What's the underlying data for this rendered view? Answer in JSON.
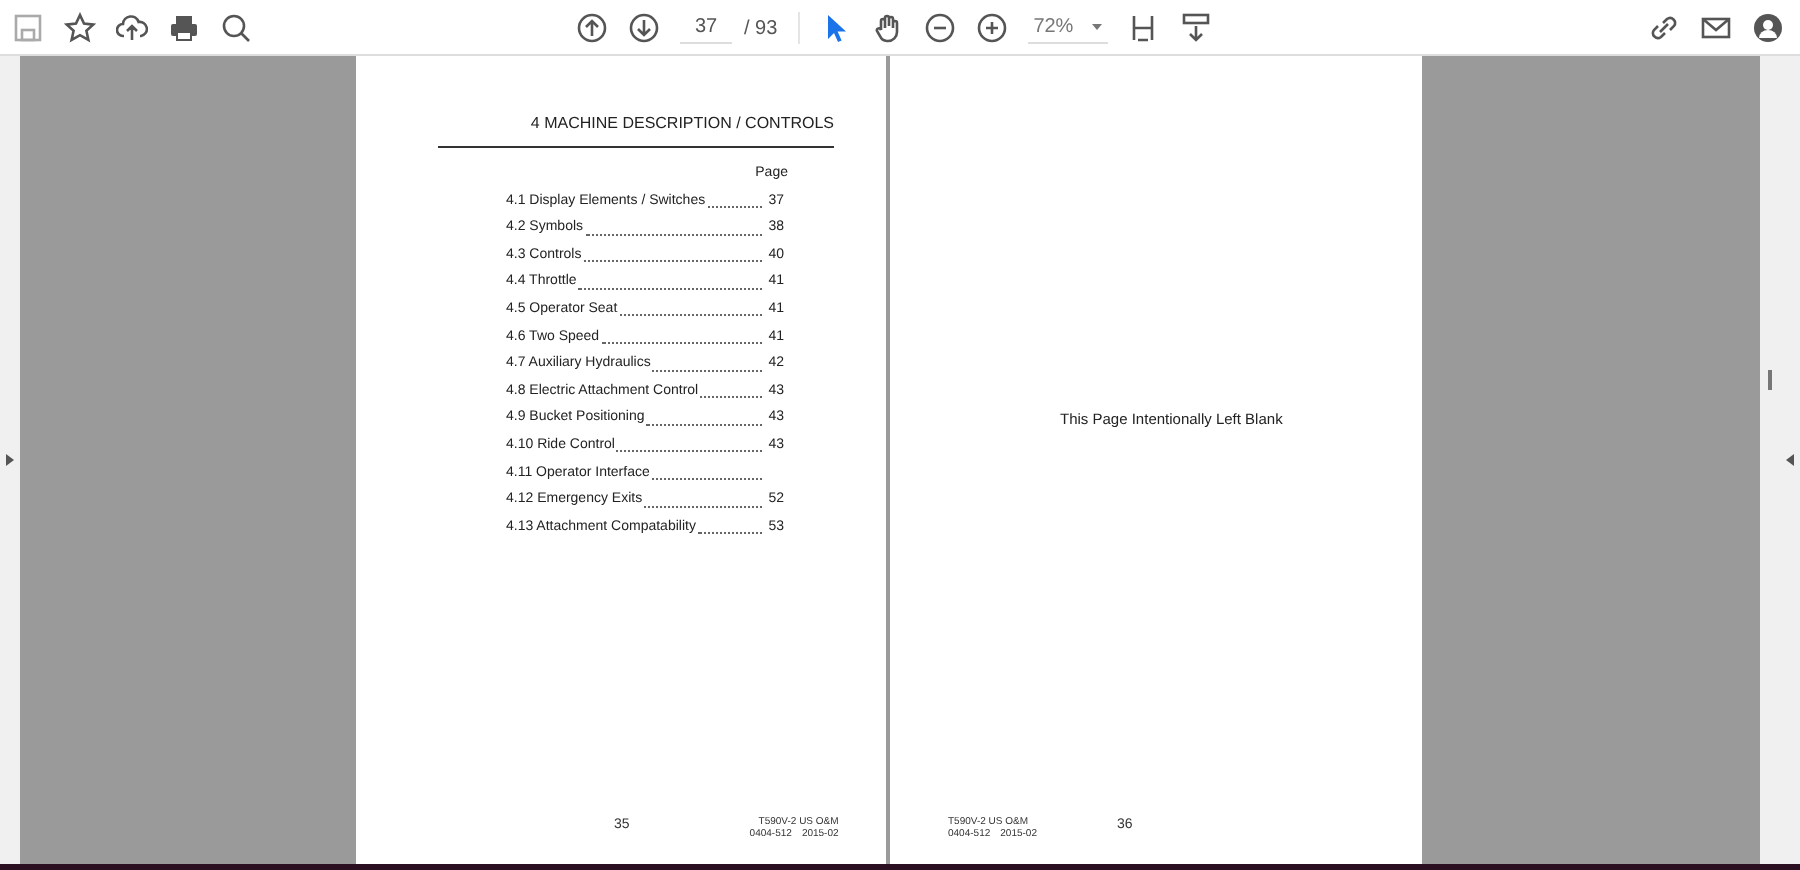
{
  "toolbar": {
    "page_number": "37",
    "page_total": "/ 93",
    "zoom": "72%"
  },
  "left_page": {
    "heading": "4 MACHINE DESCRIPTION / CONTROLS",
    "page_column_label": "Page",
    "entries": [
      {
        "title": "4.1 Display Elements / Switches",
        "page": "37"
      },
      {
        "title": "4.2 Symbols",
        "page": "38"
      },
      {
        "title": "4.3 Controls",
        "page": "40"
      },
      {
        "title": "4.4 Throttle",
        "page": "41"
      },
      {
        "title": "4.5 Operator Seat",
        "page": "41"
      },
      {
        "title": "4.6 Two Speed",
        "page": "41"
      },
      {
        "title": "4.7 Auxiliary Hydraulics",
        "page": "42"
      },
      {
        "title": "4.8 Electric Attachment Control",
        "page": "43"
      },
      {
        "title": "4.9 Bucket Positioning",
        "page": "43"
      },
      {
        "title": "4.10 Ride Control",
        "page": "43"
      },
      {
        "title": "4.11 Operator Interface"
      },
      {
        "title": "4.12 Emergency Exits",
        "page": "52"
      },
      {
        "title": "4.13 Attachment Compatability",
        "page": "53"
      }
    ],
    "page_number": "35",
    "doc_code": "T590V-2 US O&M",
    "doc_ref": "0404-512",
    "doc_date": "2015-02"
  },
  "right_page": {
    "body": "This Page Intentionally Left Blank",
    "doc_code": "T590V-2 US O&M",
    "doc_ref": "0404-512",
    "doc_date": "2015-02",
    "page_number": "36"
  }
}
